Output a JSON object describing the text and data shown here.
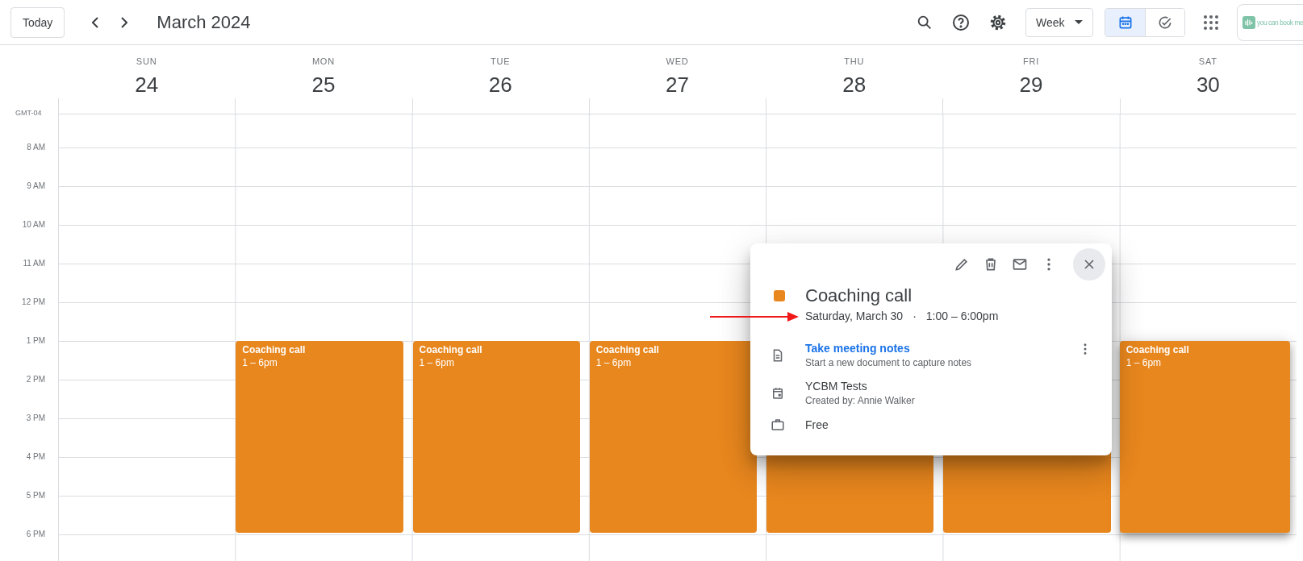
{
  "toolbar": {
    "today_button": "Today",
    "title": "March 2024",
    "view_dropdown": "Week",
    "view_toggle": [
      {
        "kind": "calendar",
        "selected": true
      },
      {
        "kind": "tasks",
        "selected": false
      }
    ],
    "logo_text": "you can book me"
  },
  "timezone": "GMT-04",
  "days": [
    {
      "weekday": "SUN",
      "date": "24"
    },
    {
      "weekday": "MON",
      "date": "25",
      "event": {
        "title": "Coaching call",
        "time": "1 – 6pm",
        "selected": false
      }
    },
    {
      "weekday": "TUE",
      "date": "26",
      "event": {
        "title": "Coaching call",
        "time": "1 – 6pm",
        "selected": false
      }
    },
    {
      "weekday": "WED",
      "date": "27",
      "event": {
        "title": "Coaching call",
        "time": "1 – 6pm",
        "selected": false
      }
    },
    {
      "weekday": "THU",
      "date": "28",
      "event": {
        "selected": false
      }
    },
    {
      "weekday": "FRI",
      "date": "29",
      "event": {
        "selected": false
      }
    },
    {
      "weekday": "SAT",
      "date": "30",
      "event": {
        "title": "Coaching call",
        "time": "1 – 6pm",
        "selected": true
      }
    }
  ],
  "hours": [
    "8 AM",
    "9 AM",
    "10 AM",
    "11 AM",
    "12 PM",
    "1 PM",
    "2 PM",
    "3 PM",
    "4 PM",
    "5 PM",
    "6 PM"
  ],
  "popup": {
    "title": "Coaching call",
    "date": "Saturday, March 30",
    "separator": "·",
    "time": "1:00 – 6:00pm",
    "notes_link": "Take meeting notes",
    "notes_hint": "Start a new document to capture notes",
    "calendar_name": "YCBM Tests",
    "created_by": "Created by: Annie Walker",
    "availability": "Free"
  }
}
